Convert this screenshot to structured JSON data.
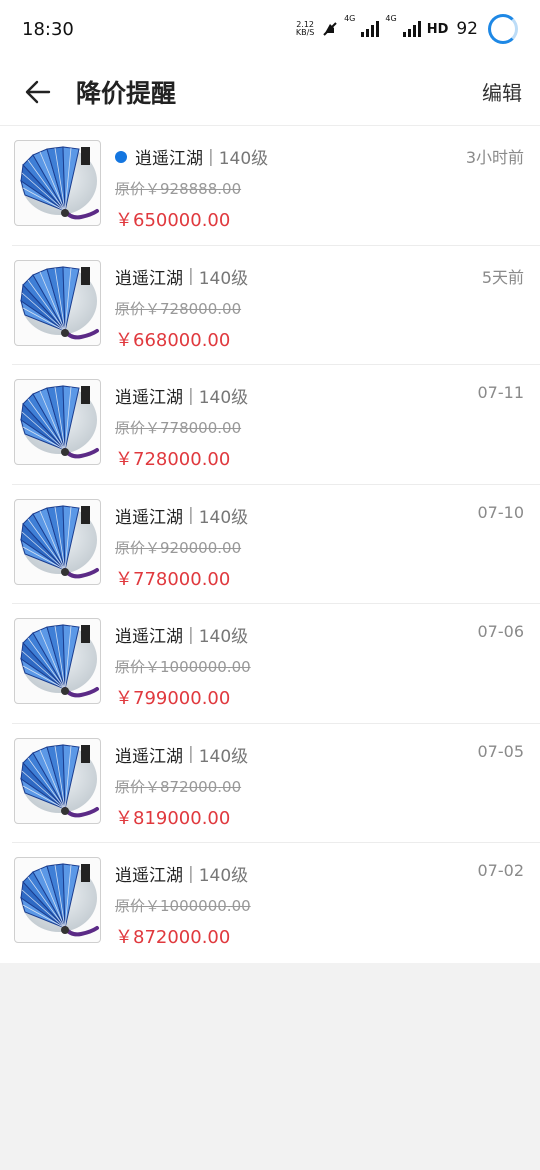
{
  "status_bar": {
    "time": "18:30",
    "net_speed_value": "2.12",
    "net_speed_unit": "KB/S",
    "network_labels": [
      "4G",
      "4G"
    ],
    "hd_label": "HD",
    "battery": "92"
  },
  "header": {
    "title": "降价提醒",
    "edit_label": "编辑"
  },
  "colors": {
    "price": "#e0393e",
    "unread_dot": "#1476e0"
  },
  "items": [
    {
      "name": "逍遥江湖",
      "separator": "|",
      "level": "140级",
      "time": "3小时前",
      "original_price": "原价￥928888.00",
      "price": "￥650000.00",
      "unread": true
    },
    {
      "name": "逍遥江湖",
      "separator": "|",
      "level": "140级",
      "time": "5天前",
      "original_price": "原价￥728000.00",
      "price": "￥668000.00",
      "unread": false
    },
    {
      "name": "逍遥江湖",
      "separator": "|",
      "level": "140级",
      "time": "07-11",
      "original_price": "原价￥778000.00",
      "price": "￥728000.00",
      "unread": false
    },
    {
      "name": "逍遥江湖",
      "separator": "|",
      "level": "140级",
      "time": "07-10",
      "original_price": "原价￥920000.00",
      "price": "￥778000.00",
      "unread": false
    },
    {
      "name": "逍遥江湖",
      "separator": "|",
      "level": "140级",
      "time": "07-06",
      "original_price": "原价￥1000000.00",
      "price": "￥799000.00",
      "unread": false
    },
    {
      "name": "逍遥江湖",
      "separator": "|",
      "level": "140级",
      "time": "07-05",
      "original_price": "原价￥872000.00",
      "price": "￥819000.00",
      "unread": false
    },
    {
      "name": "逍遥江湖",
      "separator": "|",
      "level": "140级",
      "time": "07-02",
      "original_price": "原价￥1000000.00",
      "price": "￥872000.00",
      "unread": false
    }
  ]
}
